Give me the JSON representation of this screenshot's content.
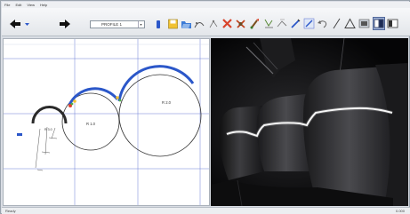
{
  "menu": [
    "File",
    "Edit",
    "View",
    "Help"
  ],
  "toolbar": {
    "profile_select": "PROFILE 1",
    "icons": [
      "back-arrow-icon",
      "forward-arrow-icon",
      "save-icon",
      "open-icon",
      "fit-arc-icon",
      "delete-icon",
      "tool-icon",
      "brush-icon",
      "measure-icon",
      "edit-icon",
      "undo-icon",
      "line-icon",
      "triangle-icon",
      "grid-icon",
      "split-view-icon",
      "full-view-icon"
    ]
  },
  "plot": {
    "arc_labels": [
      "R 1.0",
      "R 2.0",
      "R 3.0"
    ]
  },
  "status": {
    "left": "Ready",
    "right": "0.000"
  },
  "colors": {
    "arc_blue": "#2b57c9",
    "arc_dark": "#2a2a2a",
    "grid_blue": "#6d7fd6",
    "accent_red": "#e0412b",
    "accent_yellow": "#f2c230"
  }
}
